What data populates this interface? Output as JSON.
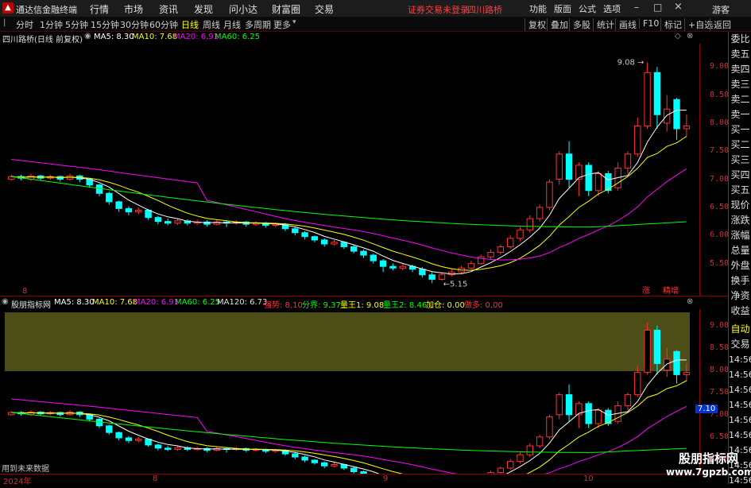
{
  "app": {
    "title": "通达信金融终端",
    "status_text": "证券交易未登录",
    "stock_name_top": "四川路桥"
  },
  "menu": [
    "行情",
    "市场",
    "资讯",
    "发现",
    "问小达",
    "财富圈",
    "交易"
  ],
  "top_right": [
    "功能",
    "版面",
    "公式",
    "选项"
  ],
  "guest_label": "游客",
  "tabs": [
    "分时",
    "1分钟",
    "5分钟",
    "15分钟",
    "30分钟",
    "60分钟",
    "日线",
    "周线",
    "月线",
    "多周期",
    "更多"
  ],
  "active_tab": "日线",
  "toolbar_right": [
    "复权",
    "叠加",
    "多股",
    "统计",
    "画线",
    "F10",
    "标记",
    "+自选",
    "返回"
  ],
  "upper_info": {
    "stock_label": "四川路桥(日线 前复权)",
    "ma5": "MA5: 8.30",
    "ma10": "MA10: 7.68",
    "ma20": "MA20: 6.91",
    "ma60": "MA60: 6.25"
  },
  "lower_info": {
    "indicator_name": "股朋指标网",
    "ma5": "MA5: 8.30",
    "ma10": "MA10: 7.68",
    "ma20": "MA20: 6.91",
    "ma60": "MA60: 6.25",
    "ma120": "MA120: 6.73",
    "chaodi": "强势: 8.10",
    "fenjie": "分界: 9.37",
    "liangwang1": "量王1: 9.08",
    "liangwang2": "量王2: 8.46",
    "jiacang": "加仓: 0.00",
    "zuoduo": "做多: 0.00"
  },
  "upper_axis": [
    "9.00",
    "8.50",
    "8.00",
    "7.50",
    "7.00",
    "6.50",
    "6.00",
    "5.50"
  ],
  "lower_axis": [
    "9.00",
    "8.50",
    "8.00",
    "7.50",
    "7.00",
    "6.50",
    "6.00"
  ],
  "lower_axis_time": [
    "14:56",
    "14:56",
    "14:56",
    "14:56",
    "14:56",
    "14:56",
    "14:56",
    "14:56",
    "14:56"
  ],
  "price_labels": {
    "high": "9.08",
    "low": "5.15"
  },
  "current_price_tag": "7.10",
  "upper_markers": {
    "zhang": "涨",
    "jiangzeng": "精增"
  },
  "auto_label": "自动",
  "jiaoyi_label": "交易",
  "future_data": "用到未来数据",
  "month_labels": [
    "2024年",
    "8",
    "9",
    "10"
  ],
  "month_label_upper": "8",
  "sidebar": [
    "委比",
    "卖五",
    "卖四",
    "卖三",
    "卖二",
    "卖一",
    "买一",
    "买二",
    "买三",
    "买四",
    "买五",
    "现价",
    "涨跌",
    "涨幅",
    "总量",
    "外盘",
    "换手",
    "净资",
    "收益"
  ],
  "watermark": {
    "line1": "股朋指标网",
    "line2": "www.7gpzb.com"
  },
  "colors": {
    "up": "#ff3232",
    "down": "#00ffff",
    "ma5": "#ffffff",
    "ma10": "#ffff00",
    "ma20": "#ff00ff",
    "ma60": "#00ff00",
    "band": "#5a5a1c"
  },
  "chart_data": {
    "type": "candlestick",
    "ylim_upper": [
      5.0,
      9.3
    ],
    "ylim_lower": [
      5.8,
      9.3
    ],
    "candles": [
      [
        7.0,
        7.05,
        6.98,
        7.08
      ],
      [
        7.05,
        7.02,
        6.98,
        7.08
      ],
      [
        7.0,
        7.06,
        6.97,
        7.1
      ],
      [
        7.06,
        7.02,
        6.98,
        7.08
      ],
      [
        7.02,
        7.05,
        6.99,
        7.08
      ],
      [
        7.05,
        7.0,
        6.96,
        7.07
      ],
      [
        7.0,
        7.06,
        6.98,
        7.1
      ],
      [
        7.06,
        7.0,
        6.95,
        7.08
      ],
      [
        7.0,
        6.9,
        6.85,
        7.02
      ],
      [
        6.9,
        6.75,
        6.7,
        6.92
      ],
      [
        6.75,
        6.6,
        6.55,
        6.78
      ],
      [
        6.6,
        6.48,
        6.42,
        6.62
      ],
      [
        6.48,
        6.42,
        6.36,
        6.52
      ],
      [
        6.42,
        6.45,
        6.38,
        6.5
      ],
      [
        6.45,
        6.32,
        6.28,
        6.47
      ],
      [
        6.32,
        6.25,
        6.2,
        6.35
      ],
      [
        6.25,
        6.22,
        6.18,
        6.3
      ],
      [
        6.22,
        6.26,
        6.19,
        6.3
      ],
      [
        6.26,
        6.22,
        6.18,
        6.29
      ],
      [
        6.22,
        6.24,
        6.19,
        6.28
      ],
      [
        6.24,
        6.2,
        6.16,
        6.27
      ],
      [
        6.2,
        6.24,
        6.18,
        6.28
      ],
      [
        6.24,
        6.22,
        6.15,
        6.26
      ],
      [
        6.22,
        6.24,
        6.19,
        6.27
      ],
      [
        6.24,
        6.2,
        6.16,
        6.26
      ],
      [
        6.2,
        6.22,
        6.17,
        6.25
      ],
      [
        6.22,
        6.18,
        6.14,
        6.24
      ],
      [
        6.18,
        6.2,
        6.15,
        6.23
      ],
      [
        6.2,
        6.12,
        6.08,
        6.22
      ],
      [
        6.12,
        6.05,
        6.0,
        6.15
      ],
      [
        6.05,
        5.98,
        5.93,
        6.08
      ],
      [
        5.98,
        5.92,
        5.88,
        6.0
      ],
      [
        5.92,
        5.85,
        5.8,
        5.95
      ],
      [
        5.85,
        5.88,
        5.82,
        5.92
      ],
      [
        5.88,
        5.8,
        5.76,
        5.9
      ],
      [
        5.8,
        5.72,
        5.68,
        5.83
      ],
      [
        5.72,
        5.65,
        5.6,
        5.75
      ],
      [
        5.65,
        5.55,
        5.5,
        5.68
      ],
      [
        5.55,
        5.45,
        5.35,
        5.58
      ],
      [
        5.45,
        5.42,
        5.38,
        5.5
      ],
      [
        5.42,
        5.45,
        5.38,
        5.5
      ],
      [
        5.45,
        5.4,
        5.35,
        5.48
      ],
      [
        5.4,
        5.3,
        5.25,
        5.44
      ],
      [
        5.3,
        5.22,
        5.15,
        5.35
      ],
      [
        5.22,
        5.3,
        5.2,
        5.35
      ],
      [
        5.3,
        5.35,
        5.27,
        5.4
      ],
      [
        5.35,
        5.42,
        5.32,
        5.46
      ],
      [
        5.42,
        5.5,
        5.4,
        5.55
      ],
      [
        5.5,
        5.62,
        5.48,
        5.66
      ],
      [
        5.62,
        5.7,
        5.58,
        5.75
      ],
      [
        5.7,
        5.8,
        5.66,
        5.84
      ],
      [
        5.8,
        5.95,
        5.76,
        6.0
      ],
      [
        5.95,
        6.1,
        5.9,
        6.15
      ],
      [
        6.1,
        6.3,
        6.05,
        6.36
      ],
      [
        6.3,
        6.5,
        6.25,
        6.55
      ],
      [
        6.5,
        6.95,
        6.45,
        7.0
      ],
      [
        7.0,
        7.45,
        6.9,
        7.5
      ],
      [
        7.45,
        7.0,
        6.85,
        7.68
      ],
      [
        7.0,
        7.25,
        6.7,
        7.3
      ],
      [
        7.25,
        6.8,
        6.7,
        7.3
      ],
      [
        6.8,
        7.1,
        6.7,
        7.15
      ],
      [
        7.1,
        6.8,
        6.75,
        7.15
      ],
      [
        6.85,
        7.2,
        6.8,
        7.3
      ],
      [
        7.2,
        7.45,
        7.1,
        7.5
      ],
      [
        7.45,
        7.95,
        7.4,
        8.1
      ],
      [
        7.95,
        8.9,
        7.9,
        9.08
      ],
      [
        8.9,
        8.15,
        7.9,
        9.0
      ],
      [
        8.0,
        8.25,
        7.85,
        8.5
      ],
      [
        8.42,
        7.9,
        7.7,
        8.45
      ],
      [
        7.9,
        7.95,
        7.75,
        8.15
      ]
    ]
  }
}
